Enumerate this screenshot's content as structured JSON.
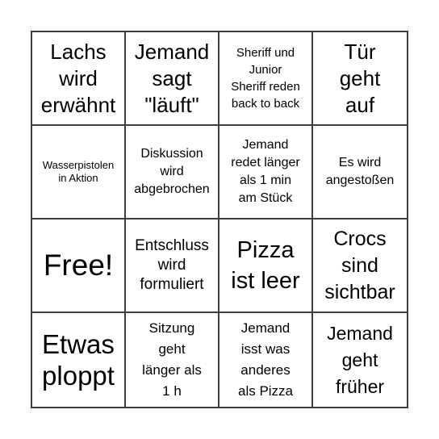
{
  "board": {
    "cells": [
      {
        "text": "Lachs\nwird\nerwähnt"
      },
      {
        "text": "Jemand\nsagt\n\"läuft\""
      },
      {
        "text": "Sheriff und\nJunior\nSheriff reden\nback to back"
      },
      {
        "text": "Tür\ngeht\nauf"
      },
      {
        "text": "Wasserpistolen\nin Aktion"
      },
      {
        "text": "Diskussion\nwird\nabgebrochen"
      },
      {
        "text": "Jemand\nredet länger\nals 1 min\nam Stück"
      },
      {
        "text": "Es wird\nangestoßen"
      },
      {
        "text": "Free!"
      },
      {
        "text": "Entschluss\nwird\nformuliert"
      },
      {
        "text": "Pizza\nist leer"
      },
      {
        "text": "Crocs\nsind\nsichtbar"
      },
      {
        "text": "Etwas\nploppt"
      },
      {
        "text": "Sitzung\ngeht\nlänger als\n1 h"
      },
      {
        "text": "Jemand\nisst was\nanderes\nals Pizza"
      },
      {
        "text": "Jemand\ngeht\nfrüher"
      }
    ]
  },
  "colors": {
    "grid_line": "#3d3d3d",
    "background": "#ffffff",
    "text": "#000000"
  }
}
